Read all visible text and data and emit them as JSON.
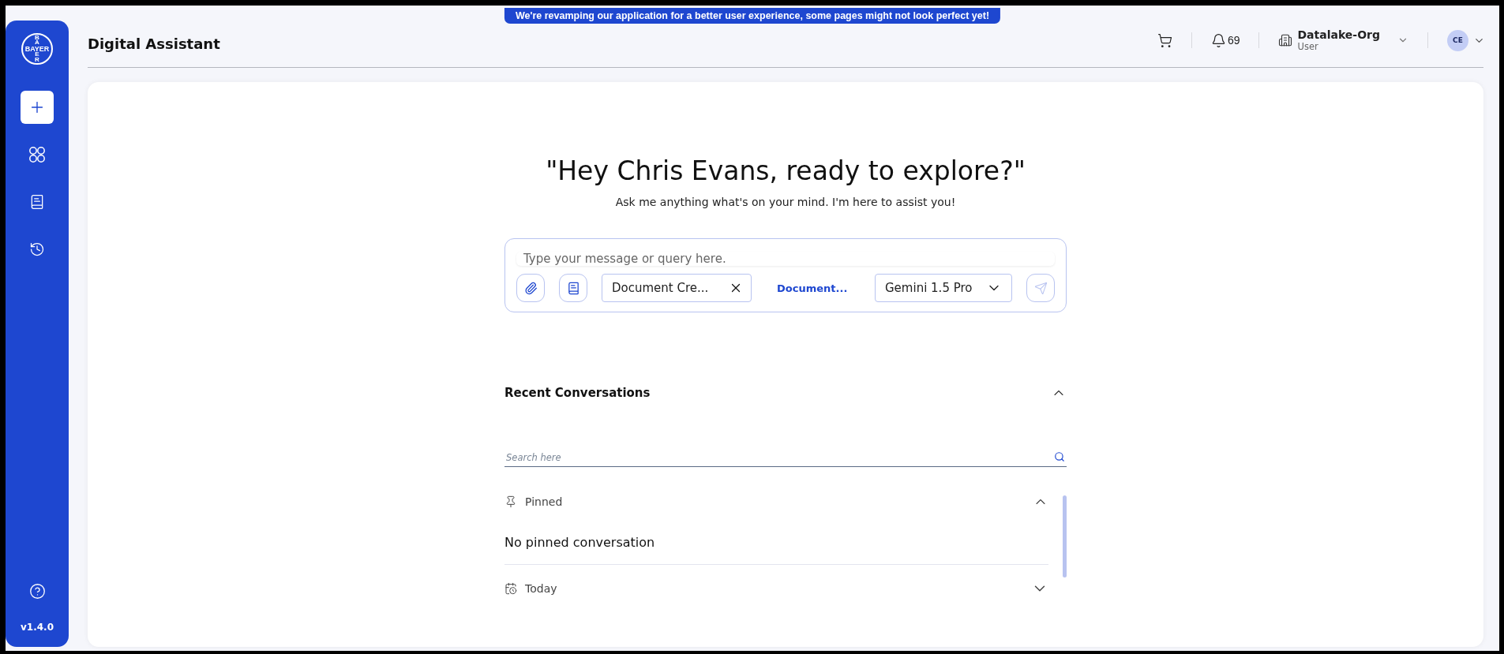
{
  "banner": {
    "text": "We're revamping our application for a better user experience, some pages might not look perfect yet!"
  },
  "sidebar": {
    "logo": {
      "horizontal": "BAYER",
      "top": "BA",
      "bottom": "ER"
    },
    "items": [
      {
        "kind": "new",
        "selected": true
      },
      {
        "kind": "apps",
        "selected": false
      },
      {
        "kind": "library",
        "selected": false
      },
      {
        "kind": "history",
        "selected": false
      }
    ],
    "version": "v1.4.0"
  },
  "header": {
    "title": "Digital Assistant",
    "notifications": "69",
    "org": {
      "name": "Datalake-Org",
      "role": "User"
    },
    "avatar": "CE"
  },
  "greeting": {
    "title": "\"Hey Chris Evans, ready to explore?\"",
    "subtitle": "Ask me anything what's on your mind. I'm here to assist you!"
  },
  "composer": {
    "placeholder": "Type your message or query here.",
    "chip": "Document Cre...",
    "link": "Document...",
    "model": "Gemini 1.5 Pro"
  },
  "recent": {
    "title": "Recent Conversations",
    "expanded": true,
    "search_placeholder": "Search here",
    "groups": [
      {
        "kind": "pinned",
        "label": "Pinned",
        "expanded": true,
        "empty": "No pinned conversation"
      },
      {
        "kind": "today",
        "label": "Today",
        "expanded": false
      }
    ]
  }
}
